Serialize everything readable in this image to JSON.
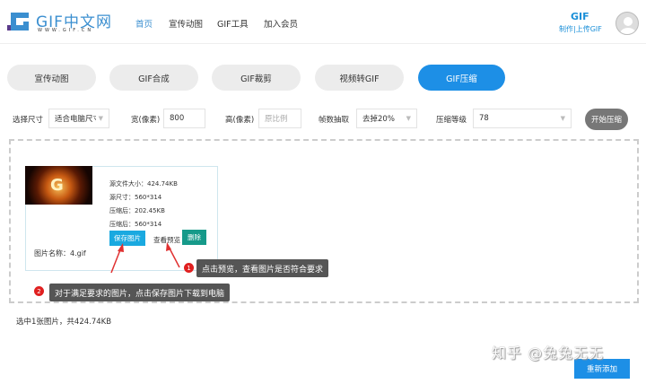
{
  "header": {
    "logo_text": "GIF中文网",
    "logo_sub": "WWW.GIF.CN",
    "nav": [
      {
        "label": "首页",
        "active": true
      },
      {
        "label": "宣传动图"
      },
      {
        "label": "GIF工具"
      },
      {
        "label": "加入会员"
      }
    ],
    "gif_title": "GIF",
    "gif_sub": "制作|上传GIF"
  },
  "tabs": [
    {
      "label": "宣传动图"
    },
    {
      "label": "GIF合成"
    },
    {
      "label": "GIF裁剪"
    },
    {
      "label": "视频转GIF"
    },
    {
      "label": "GIF压缩",
      "active": true
    }
  ],
  "options": {
    "size_label": "选择尺寸",
    "size_value": "适合电脑尺寸",
    "width_label": "宽(像素)",
    "width_value": "800",
    "height_label": "高(像素)",
    "height_placeholder": "原比例",
    "frame_label": "帧数抽取",
    "frame_value": "去掉20%",
    "level_label": "压缩等级",
    "level_value": "78",
    "start_button": "开始压缩"
  },
  "file": {
    "thumb_letter": "G",
    "source_size": "源文件大小：424.74KB",
    "source_dim": "源尺寸：560*314",
    "compressed_size": "压缩后：202.45KB",
    "compressed_dim": "压缩后：560*314",
    "save_button": "保存图片",
    "preview_link": "查看预览",
    "delete_button": "删除",
    "name": "图片名称：4.gif"
  },
  "annotations": [
    {
      "num": "1",
      "text": "点击预览，查看图片是否符合要求"
    },
    {
      "num": "2",
      "text": "对于满足要求的图片，点击保存图片下载到电脑"
    }
  ],
  "status": "选中1张图片，共424.74KB",
  "readd_button": "重新添加",
  "watermark": "知乎 @兔兔无无",
  "colors": {
    "accent": "#1d8fe6",
    "save": "#1aa9e0",
    "delete": "#169a8a",
    "annotation": "#e02020"
  }
}
